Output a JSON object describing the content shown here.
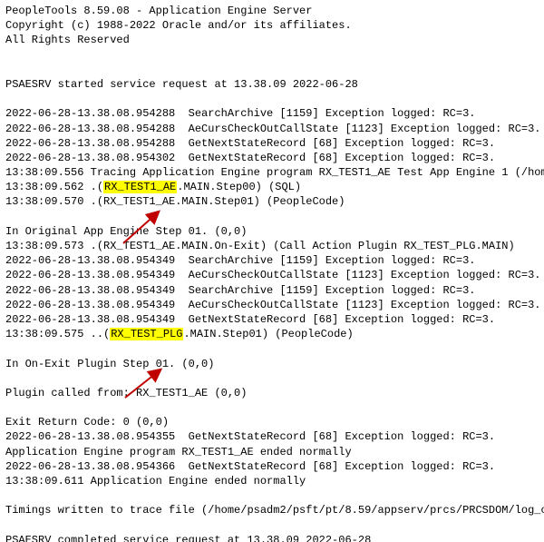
{
  "title": "PeopleTools 8.59.08 - Application Engine Server",
  "copyright": "Copyright (c) 1988-2022 Oracle and/or its affiliates.",
  "rights": "All Rights Reserved",
  "started": "PSAESRV started service request at 13.38.09 2022-06-28",
  "log_a": [
    "2022-06-28-13.38.08.954288  SearchArchive [1159] Exception logged: RC=3.",
    "2022-06-28-13.38.08.954288  AeCursCheckOutCallState [1123] Exception logged: RC=3.",
    "2022-06-28-13.38.08.954288  GetNextStateRecord [68] Exception logged: RC=3.",
    "2022-06-28-13.38.08.954302  GetNextStateRecord [68] Exception logged: RC=3.",
    "13:38:09.556 Tracing Application Engine program RX_TEST1_AE Test App Engine 1 (/hom"
  ],
  "hl1_prefix": "13:38:09.562 .(",
  "hl1_text": "RX_TEST1_AE",
  "hl1_suffix": ".MAIN.Step00) (SQL)",
  "log_a_end": "13:38:09.570 .(RX_TEST1_AE.MAIN.Step01) (PeopleCode)",
  "orig_step": "In Original App Engine Step 01. (0,0)",
  "log_b": [
    "13:38:09.573 .(RX_TEST1_AE.MAIN.On-Exit) (Call Action Plugin RX_TEST_PLG.MAIN)",
    "2022-06-28-13.38.08.954349  SearchArchive [1159] Exception logged: RC=3.",
    "2022-06-28-13.38.08.954349  AeCursCheckOutCallState [1123] Exception logged: RC=3.",
    "2022-06-28-13.38.08.954349  SearchArchive [1159] Exception logged: RC=3.",
    "2022-06-28-13.38.08.954349  AeCursCheckOutCallState [1123] Exception logged: RC=3.",
    "2022-06-28-13.38.08.954349  GetNextStateRecord [68] Exception logged: RC=3."
  ],
  "hl2_prefix": "13:38:09.575 ..(",
  "hl2_text": "RX_TEST_PLG",
  "hl2_suffix": ".MAIN.Step01) (PeopleCode)",
  "onexit": "In On-Exit Plugin Step 01. (0,0)",
  "called_from": "Plugin called from: RX_TEST1_AE (0,0)",
  "exit_code": "Exit Return Code: 0 (0,0)",
  "log_c": [
    "2022-06-28-13.38.08.954355  GetNextStateRecord [68] Exception logged: RC=3.",
    "Application Engine program RX_TEST1_AE ended normally",
    "2022-06-28-13.38.08.954366  GetNextStateRecord [68] Exception logged: RC=3.",
    "13:38:09.611 Application Engine ended normally"
  ],
  "timings": "Timings written to trace file (/home/psadm2/psft/pt/8.59/appserv/prcs/PRCSDOM/log_o",
  "completed": "PSAESRV completed service request at 13.38.09 2022-06-28",
  "arrow_color": "#c00000"
}
